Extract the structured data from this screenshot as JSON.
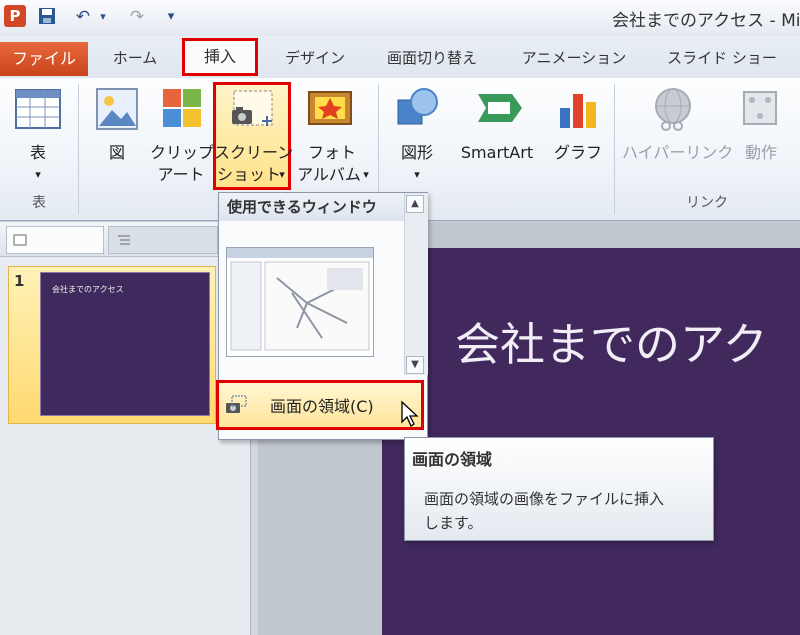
{
  "window": {
    "title": "会社までのアクセス - Mi"
  },
  "quick_access": {
    "app_icon": "P",
    "undo": "↶",
    "redo": "↷",
    "customize": "▾"
  },
  "tabs": [
    {
      "label": "ファイル"
    },
    {
      "label": "ホーム"
    },
    {
      "label": "挿入"
    },
    {
      "label": "デザイン"
    },
    {
      "label": "画面切り替え"
    },
    {
      "label": "アニメーション"
    },
    {
      "label": "スライド ショー"
    }
  ],
  "ribbon": {
    "table": {
      "label": "表",
      "group": "表"
    },
    "picture": {
      "label": "図"
    },
    "clipart": {
      "label1": "クリップ",
      "label2": "アート"
    },
    "screenshot": {
      "label1": "スクリーン",
      "label2": "ショット"
    },
    "photoalbum": {
      "label1": "フォト",
      "label2": "アルバム"
    },
    "shapes": {
      "label": "図形"
    },
    "smartart": {
      "label": "SmartArt"
    },
    "chart": {
      "label": "グラフ"
    },
    "hyperlink": {
      "label": "ハイパーリンク"
    },
    "action": {
      "label": "動作"
    },
    "links_group": "リンク"
  },
  "slides": [
    {
      "number": "1",
      "title": "会社までのアクセス"
    }
  ],
  "slide": {
    "title": "会社までのアク"
  },
  "gallery": {
    "header": "使用できるウィンドウ",
    "screen_clipping": "画面の領域(C)"
  },
  "tooltip": {
    "title": "画面の領域",
    "body_line1": "画面の領域の画像をファイルに挿入",
    "body_line2": "します。"
  },
  "colors": {
    "accent_red": "#e00000",
    "slide_bg": "#41295e",
    "file_tab": "#d24726"
  }
}
